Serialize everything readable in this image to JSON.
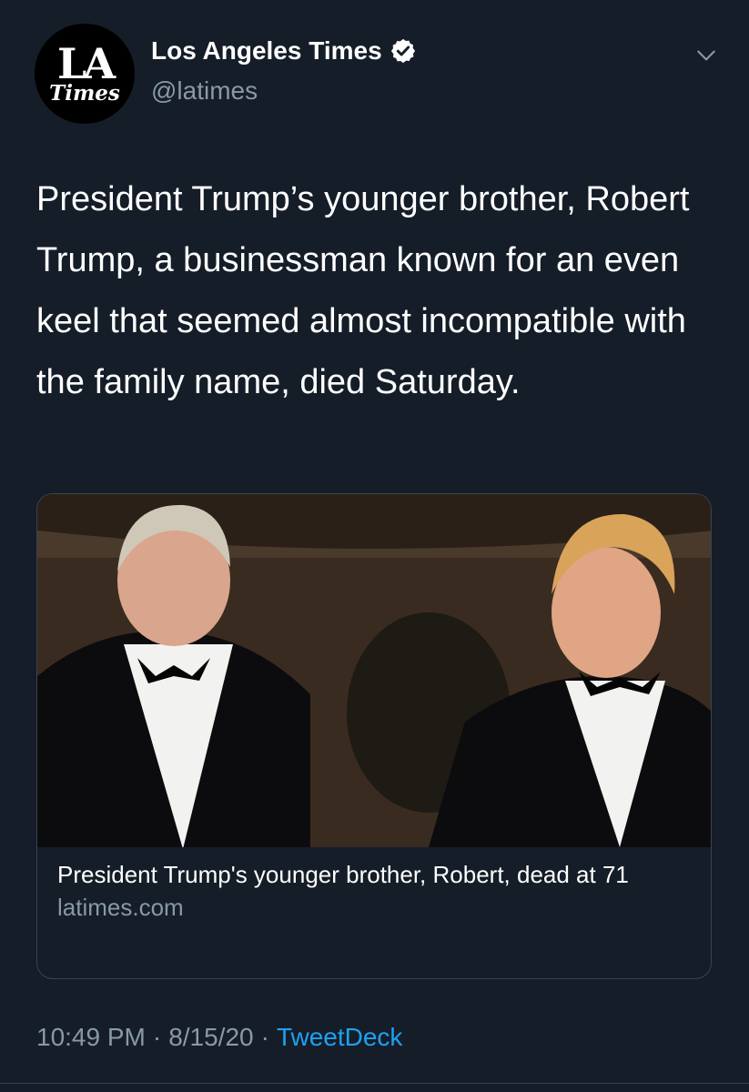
{
  "account": {
    "avatar_line1": "LA",
    "avatar_line2": "Times",
    "display_name": "Los Angeles Times",
    "handle": "@latimes",
    "verified_icon": "verified-badge-icon"
  },
  "tweet": {
    "text": "President Trump’s younger brother, Robert Trump, a businessman known for an even keel that seemed almost incompatible with the family name, died Saturday."
  },
  "card": {
    "image_description_icon": "photo",
    "title": "President Trump's younger brother, Robert, dead at 71",
    "domain": "latimes.com"
  },
  "footer": {
    "time": "10:49 PM",
    "separator": "·",
    "date": "8/15/20",
    "source": "TweetDeck"
  },
  "colors": {
    "background": "#151d28",
    "secondary_text": "#8899a6",
    "link": "#1da1f2",
    "border": "#38444d"
  }
}
